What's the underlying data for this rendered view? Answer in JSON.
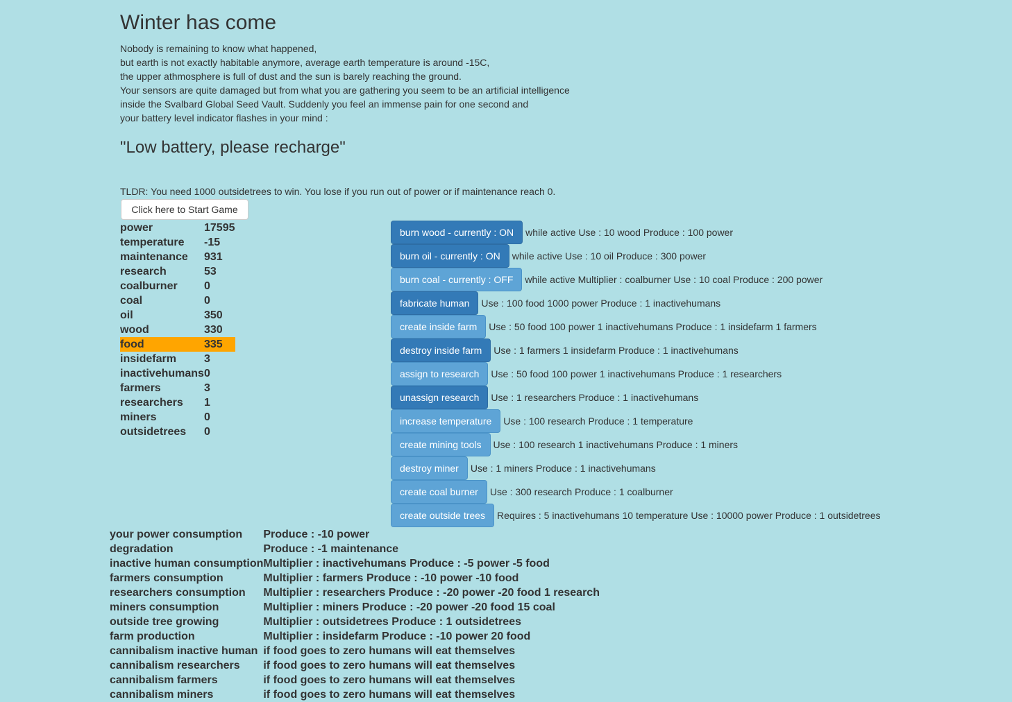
{
  "title": "Winter has come",
  "story": [
    "Nobody is remaining to know what happened,",
    "but earth is not exactly habitable anymore, average earth temperature is around -15C,",
    "the upper athmosphere is full of dust and the sun is barely reaching the ground.",
    "Your sensors are quite damaged but from what you are gathering you seem to be an artificial intelligence",
    "inside the Svalbard Global Seed Vault. Suddenly you feel an immense pain for one second and",
    "your battery level indicator flashes in your mind :"
  ],
  "quote": "\"Low battery, please recharge\"",
  "tldr": "TLDR: You need 1000 outsidetrees to win. You lose if you run out of power or if maintenance reach 0.",
  "start_button": "Click here to Start Game",
  "highlight_color": "#ffa500",
  "resources": [
    {
      "name": "power",
      "value": "17595"
    },
    {
      "name": "temperature",
      "value": "-15"
    },
    {
      "name": "maintenance",
      "value": "931"
    },
    {
      "name": "research",
      "value": "53"
    },
    {
      "name": "coalburner",
      "value": "0"
    },
    {
      "name": "coal",
      "value": "0"
    },
    {
      "name": "oil",
      "value": "350"
    },
    {
      "name": "wood",
      "value": "330"
    },
    {
      "name": "food",
      "value": "335",
      "highlight": true
    },
    {
      "name": "insidefarm",
      "value": "3"
    },
    {
      "name": "inactivehumans",
      "value": "0"
    },
    {
      "name": "farmers",
      "value": "3"
    },
    {
      "name": "researchers",
      "value": "1"
    },
    {
      "name": "miners",
      "value": "0"
    },
    {
      "name": "outsidetrees",
      "value": "0"
    }
  ],
  "actions": [
    {
      "label": "burn wood - currently : ON",
      "desc": "while active Use : 10 wood Produce : 100 power",
      "active": true
    },
    {
      "label": "burn oil - currently : ON",
      "desc": "while active Use : 10 oil Produce : 300 power",
      "active": true
    },
    {
      "label": "burn coal - currently : OFF",
      "desc": "while active Multiplier : coalburner Use : 10 coal Produce : 200 power",
      "active": false
    },
    {
      "label": "fabricate human",
      "desc": "Use : 100 food 1000 power Produce : 1 inactivehumans",
      "active": true
    },
    {
      "label": "create inside farm",
      "desc": "Use : 50 food 100 power 1 inactivehumans Produce : 1 insidefarm 1 farmers",
      "active": false
    },
    {
      "label": "destroy inside farm",
      "desc": "Use : 1 farmers 1 insidefarm Produce : 1 inactivehumans",
      "active": true
    },
    {
      "label": "assign to research",
      "desc": "Use : 50 food 100 power 1 inactivehumans Produce : 1 researchers",
      "active": false
    },
    {
      "label": "unassign research",
      "desc": "Use : 1 researchers Produce : 1 inactivehumans",
      "active": true
    },
    {
      "label": "increase temperature",
      "desc": "Use : 100 research Produce : 1 temperature",
      "active": false
    },
    {
      "label": "create mining tools",
      "desc": "Use : 100 research 1 inactivehumans Produce : 1 miners",
      "active": false
    },
    {
      "label": "destroy miner",
      "desc": "Use : 1 miners Produce : 1 inactivehumans",
      "active": false
    },
    {
      "label": "create coal burner",
      "desc": "Use : 300 research Produce : 1 coalburner",
      "active": false
    },
    {
      "label": "create outside trees",
      "desc": "Requires : 5 inactivehumans 10 temperature Use : 10000 power Produce : 1 outsidetrees",
      "active": false
    }
  ],
  "effects": [
    {
      "name": "your power consumption",
      "desc": "Produce : -10 power"
    },
    {
      "name": "degradation",
      "desc": "Produce : -1 maintenance"
    },
    {
      "name": "inactive human consumption",
      "desc": "Multiplier : inactivehumans Produce : -5 power -5 food"
    },
    {
      "name": "farmers consumption",
      "desc": "Multiplier : farmers Produce : -10 power -10 food"
    },
    {
      "name": "researchers consumption",
      "desc": "Multiplier : researchers Produce : -20 power -20 food 1 research"
    },
    {
      "name": "miners consumption",
      "desc": "Multiplier : miners Produce : -20 power -20 food 15 coal"
    },
    {
      "name": "outside tree growing",
      "desc": "Multiplier : outsidetrees Produce : 1 outsidetrees"
    },
    {
      "name": "farm production",
      "desc": "Multiplier : insidefarm Produce : -10 power 20 food"
    },
    {
      "name": "cannibalism inactive human",
      "desc": "if food goes to zero humans will eat themselves"
    },
    {
      "name": "cannibalism researchers",
      "desc": "if food goes to zero humans will eat themselves"
    },
    {
      "name": "cannibalism farmers",
      "desc": "if food goes to zero humans will eat themselves"
    },
    {
      "name": "cannibalism miners",
      "desc": "if food goes to zero humans will eat themselves"
    }
  ]
}
